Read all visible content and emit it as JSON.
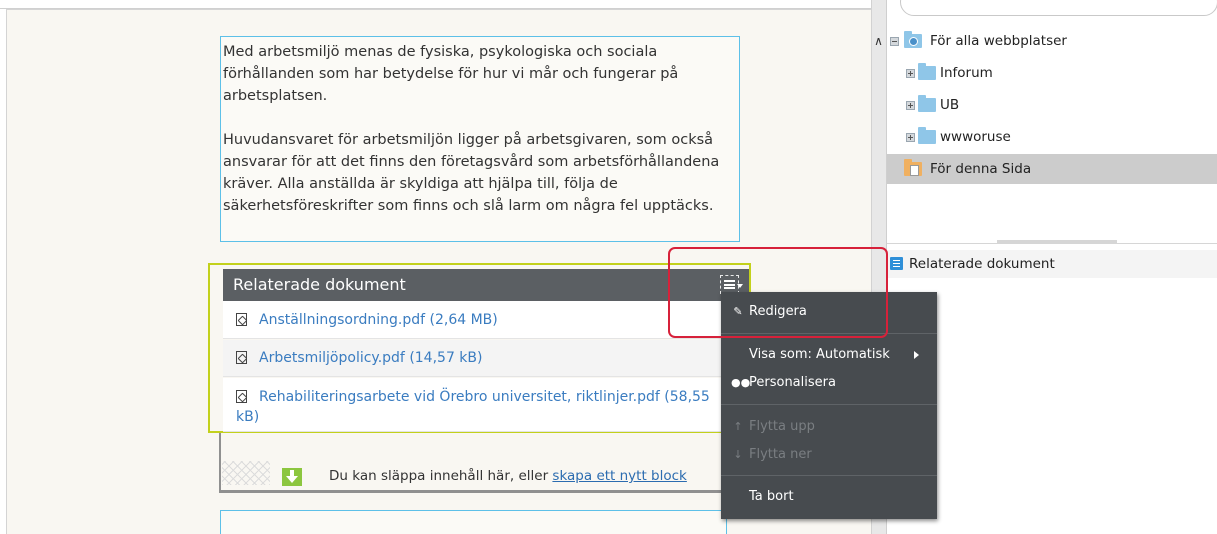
{
  "editor": {
    "text_paragraphs": [
      "Med arbetsmiljö menas de fysiska, psykologiska och sociala förhållanden som har betydelse för hur vi mår och fungerar på arbetsplatsen.",
      "Huvudansvaret för arbetsmiljön ligger på arbetsgivaren, som också ansvarar för att det finns den företagsvård som arbetsförhållandena kräver. Alla anställda är skyldiga att hjälpa till, följa de säkerhetsföreskrifter som finns och slå larm om några fel upptäcks."
    ],
    "related_block": {
      "title": "Relaterade dokument",
      "documents": [
        {
          "name": "Anställningsordning.pdf",
          "size": "(2,64 MB)"
        },
        {
          "name": "Arbetsmiljöpolicy.pdf",
          "size": "(14,57 kB)"
        },
        {
          "name": "Rehabiliteringsarbete vid Örebro universitet, riktlinjer.pdf",
          "size": "(58,55 kB)"
        }
      ]
    },
    "drop_zone": {
      "text": "Du kan släppa innehåll här, eller",
      "link": "skapa ett nytt block"
    }
  },
  "context_menu": {
    "edit": "Redigera",
    "display_as": "Visa som: Automatisk",
    "personalize": "Personalisera",
    "move_up": "Flytta upp",
    "move_down": "Flytta ner",
    "remove": "Ta bort"
  },
  "right_panel": {
    "tree": [
      {
        "label": "För alla webbplatser",
        "type": "root"
      },
      {
        "label": "Inforum",
        "type": "folder"
      },
      {
        "label": "UB",
        "type": "folder"
      },
      {
        "label": "wwworuse",
        "type": "folder"
      },
      {
        "label": "För denna Sida",
        "type": "page",
        "selected": true
      }
    ],
    "blocks_item": "Relaterade dokument"
  },
  "colors": {
    "accent_blue": "#5dc0e8",
    "selected_block_border": "#c3d11c",
    "highlight_red": "#d7213a",
    "link_blue": "#3a7cc0",
    "menu_bg": "#474b4f"
  }
}
